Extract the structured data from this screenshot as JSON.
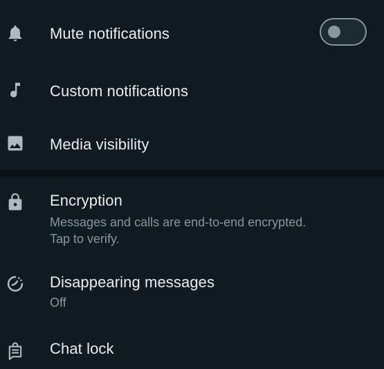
{
  "settings": {
    "mute": {
      "label": "Mute notifications",
      "enabled": false,
      "icon": "bell-icon"
    },
    "custom": {
      "label": "Custom notifications",
      "icon": "music-note-icon"
    },
    "media": {
      "label": "Media visibility",
      "icon": "image-icon"
    },
    "encryption": {
      "label": "Encryption",
      "subtitle_line1": "Messages and calls are end-to-end encrypted.",
      "subtitle_line2": "Tap to verify.",
      "icon": "lock-icon"
    },
    "disappearing": {
      "label": "Disappearing messages",
      "value": "Off",
      "icon": "timer-icon"
    },
    "chatlock": {
      "label": "Chat lock",
      "icon": "chat-lock-icon"
    }
  },
  "colors": {
    "background": "#101b21",
    "primary_text": "#e9edef",
    "secondary_text": "#8696a0",
    "icon": "#aebac1"
  }
}
